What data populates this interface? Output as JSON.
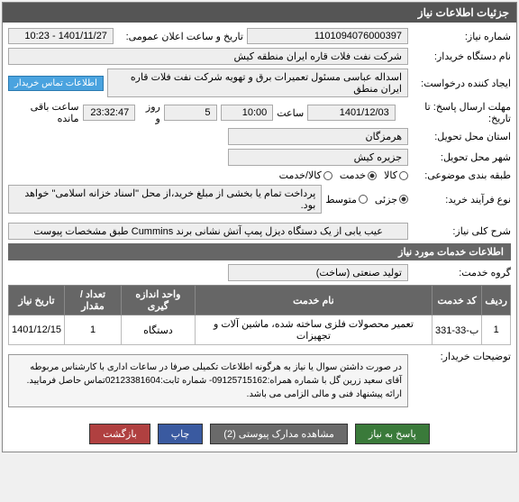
{
  "panel_title": "جزئیات اطلاعات نیاز",
  "fields": {
    "need_no_label": "شماره نیاز:",
    "need_no": "1101094076000397",
    "announce_label": "تاریخ و ساعت اعلان عمومی:",
    "announce": "1401/11/27 - 10:23",
    "buyer_label": "نام دستگاه خریدار:",
    "buyer": "شرکت نفت فلات قاره ایران منطقه کیش",
    "creator_label": "ایجاد کننده درخواست:",
    "creator": "اسداله عباسی مسئول تعمیرات برق و تهویه شرکت نفت فلات قاره ایران منطق",
    "contact_btn": "اطلاعات تماس خریدار",
    "deadline_label": "مهلت ارسال پاسخ: تا تاریخ:",
    "deadline_date": "1401/12/03",
    "time_label": "ساعت",
    "deadline_time": "10:00",
    "day_label": "روز و",
    "days": "5",
    "remain_time": "23:32:47",
    "remain_label": "ساعت باقی مانده",
    "province_label": "استان محل تحویل:",
    "province": "هرمزگان",
    "city_label": "شهر محل تحویل:",
    "city": "جزیره کیش",
    "topic_label": "طبقه بندی موضوعی:",
    "topic_goods": "کالا",
    "topic_service": "خدمت",
    "topic_both": "کالا/خدمت",
    "process_label": "نوع فرآیند خرید:",
    "process_partial": "جزئی",
    "process_medium": "متوسط",
    "process_note": "پرداخت تمام یا بخشی از مبلغ خرید،از محل \"اسناد خزانه اسلامی\" خواهد بود."
  },
  "desc": {
    "title": "شرح کلی نیاز:",
    "text": "عیب یابی از یک دستگاه دیزل پمپ آتش نشانی برند Cummins طبق مشخصات پیوست"
  },
  "services_section": "اطلاعات خدمات مورد نیاز",
  "service_group_label": "گروه خدمت:",
  "service_group": "تولید صنعتی (ساخت)",
  "table": {
    "headers": [
      "ردیف",
      "کد خدمت",
      "نام خدمت",
      "واحد اندازه گیری",
      "تعداد / مقدار",
      "تاریخ نیاز"
    ],
    "rows": [
      [
        "1",
        "ب-33-331",
        "تعمیر محصولات فلزی ساخته شده، ماشین آلات و تجهیزات",
        "دستگاه",
        "1",
        "1401/12/15"
      ]
    ]
  },
  "note_label": "توضیحات خریدار:",
  "note": "در صورت داشتن سوال یا نیاز به هرگونه اطلاعات تکمیلی صرفا در ساعات اداری با کارشناس مربوطه آقای سعید زرین گل با شماره همراه:09125715162- شماره ثابت:02123381604تماس حاصل فرمایید. ارائه پیشنهاد فنی و مالی الزامی می باشد.",
  "buttons": {
    "respond": "پاسخ به نیاز",
    "docs": "مشاهده مدارک پیوستی   (2)",
    "print": "چاپ",
    "return": "بازگشت"
  }
}
